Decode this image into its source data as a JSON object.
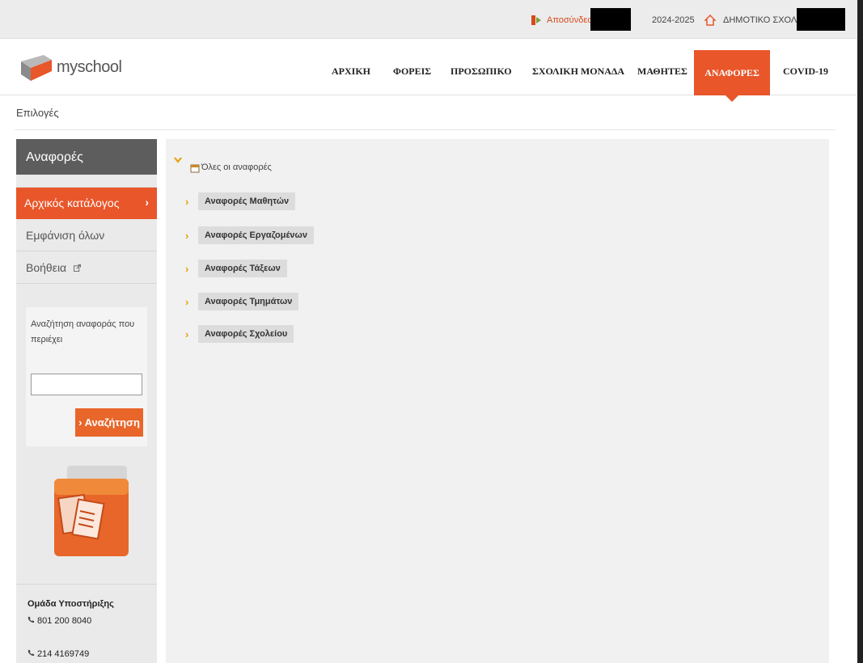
{
  "topbar": {
    "logout_label": "Αποσύνδεση",
    "year": "2024-2025",
    "school_label": "ΔΗΜΟΤΙΚΟ ΣΧΟΛΕΙΟ"
  },
  "logo": {
    "text": "myschool"
  },
  "nav": {
    "items": [
      "ΑΡΧΙΚΗ",
      "ΦΟΡΕΙΣ",
      "ΠΡΟΣΩΠΙΚΟ",
      "ΣΧΟΛΙΚΗ ΜΟΝΑΔΑ",
      "ΜΑΘΗΤΕΣ",
      "ΑΝΑΦΟΡΕΣ",
      "COVID-19"
    ],
    "active": "ΑΝΑΦΟΡΕΣ"
  },
  "breadcrumb": {
    "options": "Επιλογές"
  },
  "sidebar": {
    "title": "Αναφορές",
    "active_item": "Αρχικός κατάλογος",
    "show_all": "Εμφάνιση όλων",
    "help": "Βοήθεια",
    "search_label": "Αναζήτηση αναφοράς που περιέχει",
    "search_value": "",
    "search_button": "› Αναζήτηση",
    "support_title": "Ομάδα Υποστήριξης",
    "phone1": "801 200 8040",
    "phone2": "214 4169749"
  },
  "tree": {
    "root": "Όλες οι αναφορές",
    "items": [
      "Αναφορές Μαθητών",
      "Αναφορές Εργαζομένων",
      "Αναφορές Τάξεων",
      "Αναφορές Τμημάτων",
      "Αναφορές Σχολείου"
    ]
  },
  "colors": {
    "accent": "#e8562a",
    "sidebar_title_bg": "#5d5d5d",
    "chevron": "#e8a20c"
  }
}
